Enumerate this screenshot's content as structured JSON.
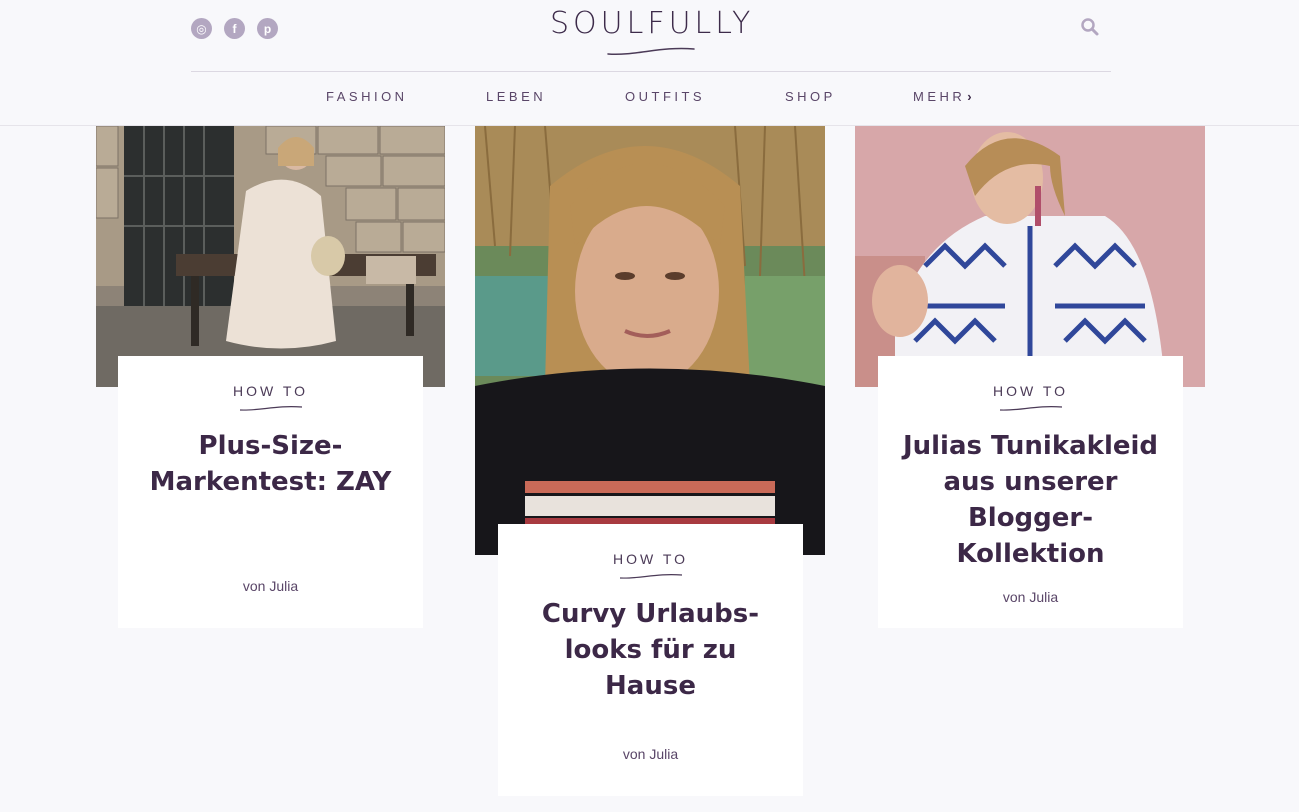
{
  "header": {
    "logo": "SOULFULLY",
    "social": [
      {
        "icon": "instagram-icon",
        "glyph": "◎"
      },
      {
        "icon": "facebook-icon",
        "glyph": "f"
      },
      {
        "icon": "pinterest-icon",
        "glyph": "p"
      }
    ],
    "search_icon": "search-icon"
  },
  "nav": {
    "items": [
      {
        "label": "FASHION"
      },
      {
        "label": "LEBEN"
      },
      {
        "label": "OUTFITS"
      },
      {
        "label": "SHOP"
      },
      {
        "label": "MEHR"
      }
    ],
    "more_chevron": "›"
  },
  "posts": [
    {
      "category": "HOW TO",
      "title": "Plus-Size-Markentest: ZAY",
      "title_lines": [
        "Plus-Size-",
        "Markentest: ZAY"
      ],
      "author": "von Julia"
    },
    {
      "category": "HOW TO",
      "title": "Curvy Urlaubs-looks für zu Hause",
      "title_lines": [
        "Curvy Urlaubs-",
        "looks für zu",
        "Hause"
      ],
      "author": "von Julia"
    },
    {
      "category": "HOW TO",
      "title": "Julias Tunikakleid aus unserer Blogger-Kollektion",
      "title_lines": [
        "Julias Tunikakleid",
        "aus unserer",
        "Blogger-",
        "Kollektion"
      ],
      "author": "von Julia"
    }
  ],
  "colors": {
    "accent": "#3c2847",
    "icon_bg": "#b3a7c1",
    "background": "#f8f8fb"
  }
}
